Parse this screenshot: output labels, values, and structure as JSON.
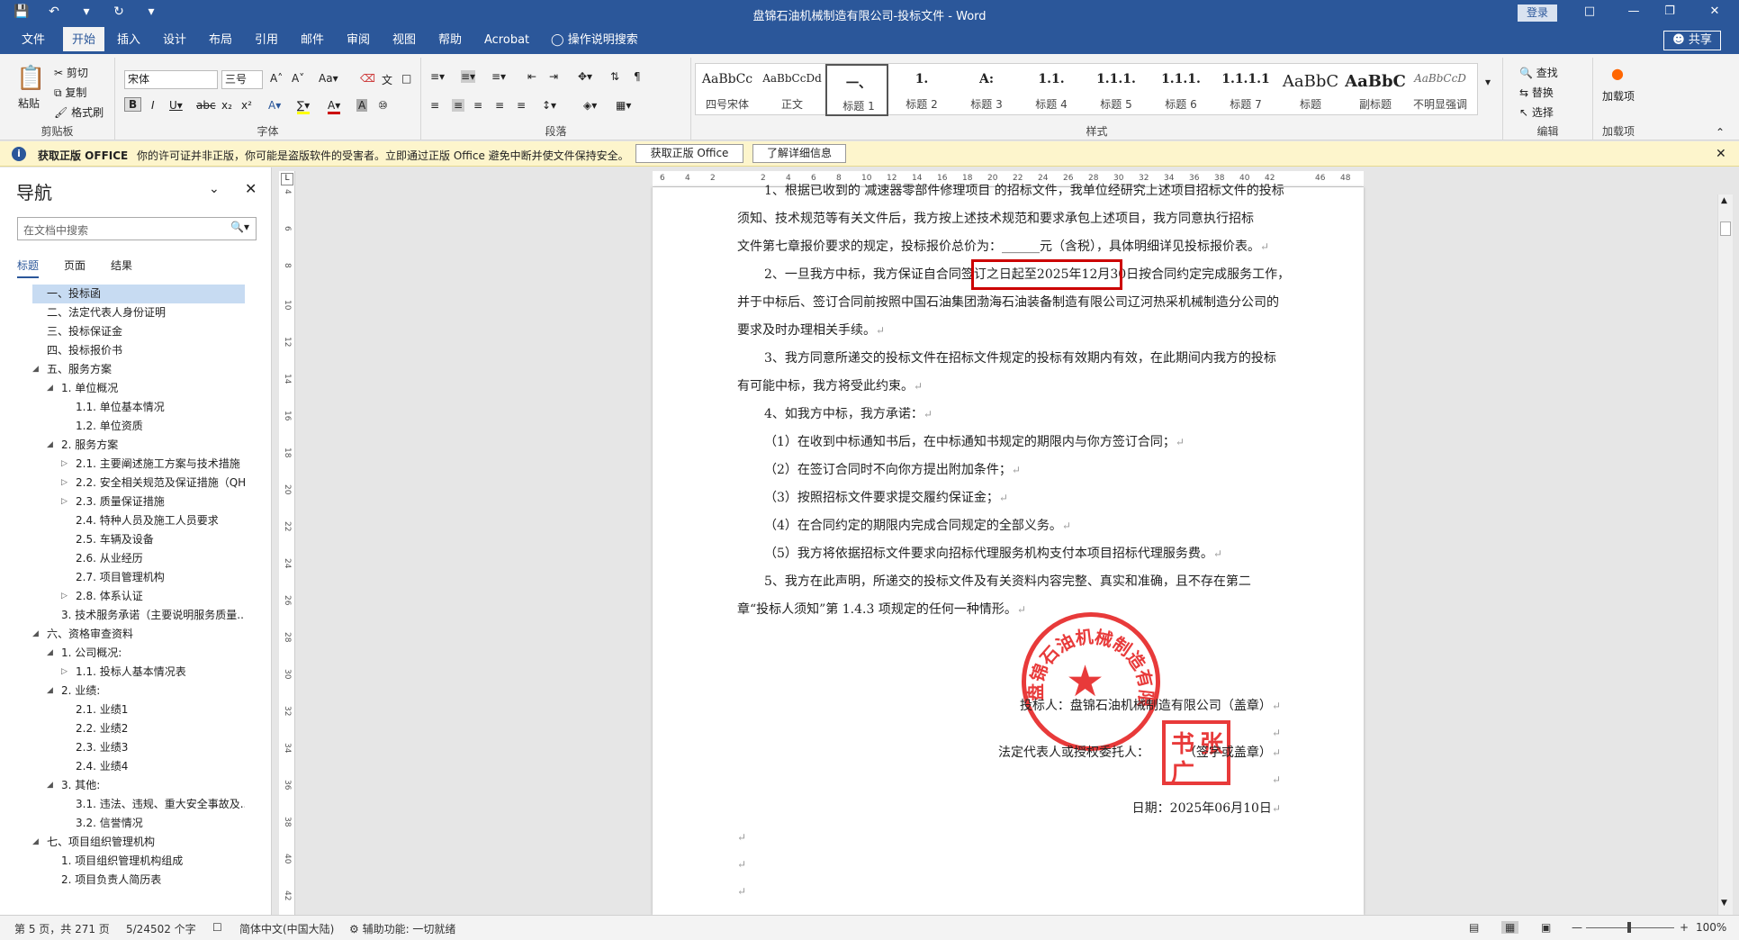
{
  "titlebar": {
    "title": "盘锦石油机械制造有限公司-投标文件  -  Word",
    "login": "登录"
  },
  "tabs": [
    "文件",
    "开始",
    "插入",
    "设计",
    "布局",
    "引用",
    "邮件",
    "审阅",
    "视图",
    "帮助",
    "Acrobat",
    "操作说明搜索"
  ],
  "share_label": "共享",
  "ribbon": {
    "clipboard": {
      "paste": "粘贴",
      "cut": "剪切",
      "copy": "复制",
      "format_painter": "格式刷",
      "label": "剪贴板"
    },
    "font": {
      "name": "宋体",
      "size": "三号",
      "label": "字体"
    },
    "paragraph": {
      "label": "段落"
    },
    "styles": {
      "label": "样式",
      "items": [
        {
          "preview": "AaBbCc",
          "name": "四号宋体"
        },
        {
          "preview": "AaBbCcDd",
          "name": "正文"
        },
        {
          "preview": "一、",
          "name": "标题 1"
        },
        {
          "preview": "1.",
          "name": "标题 2"
        },
        {
          "preview": "A:",
          "name": "标题 3"
        },
        {
          "preview": "1.1.",
          "name": "标题 4"
        },
        {
          "preview": "1.1.1.",
          "name": "标题 5"
        },
        {
          "preview": "1.1.1.",
          "name": "标题 6"
        },
        {
          "preview": "1.1.1.1",
          "name": "标题 7"
        },
        {
          "preview": "AaBbC",
          "name": "标题"
        },
        {
          "preview": "AaBbC",
          "name": "副标题"
        },
        {
          "preview": "AaBbCcD",
          "name": "不明显强调"
        }
      ]
    },
    "editing": {
      "find": "查找",
      "replace": "替换",
      "select": "选择",
      "label": "编辑"
    },
    "addins": {
      "button": "加载项",
      "label": "加载项"
    }
  },
  "message_bar": {
    "bold": "获取正版 OFFICE",
    "text": "你的许可证并非正版，你可能是盗版软件的受害者。立即通过正版 Office 避免中断并使文件保持安全。",
    "btn1": "获取正版 Office",
    "btn2": "了解详细信息"
  },
  "nav": {
    "heading": "导航",
    "search_placeholder": "在文档中搜索",
    "tabs": [
      "标题",
      "页面",
      "结果"
    ],
    "items": [
      {
        "text": "一、投标函",
        "indent": 0,
        "selected": true,
        "expand": ""
      },
      {
        "text": "二、法定代表人身份证明",
        "indent": 0,
        "expand": ""
      },
      {
        "text": "三、投标保证金",
        "indent": 0,
        "expand": ""
      },
      {
        "text": "四、投标报价书",
        "indent": 0,
        "expand": ""
      },
      {
        "text": "五、服务方案",
        "indent": 0,
        "expand": "open"
      },
      {
        "text": "1. 单位概况",
        "indent": 1,
        "expand": "open"
      },
      {
        "text": "1.1. 单位基本情况",
        "indent": 2,
        "expand": ""
      },
      {
        "text": "1.2. 单位资质",
        "indent": 2,
        "expand": ""
      },
      {
        "text": "2. 服务方案",
        "indent": 1,
        "expand": "open"
      },
      {
        "text": "2.1. 主要阐述施工方案与技术措施",
        "indent": 2,
        "expand": "closed"
      },
      {
        "text": "2.2. 安全相关规范及保证措施（QH...",
        "indent": 2,
        "expand": "closed"
      },
      {
        "text": "2.3. 质量保证措施",
        "indent": 2,
        "expand": "closed"
      },
      {
        "text": "2.4. 特种人员及施工人员要求",
        "indent": 2,
        "expand": ""
      },
      {
        "text": "2.5. 车辆及设备",
        "indent": 2,
        "expand": ""
      },
      {
        "text": "2.6. 从业经历",
        "indent": 2,
        "expand": ""
      },
      {
        "text": "2.7. 项目管理机构",
        "indent": 2,
        "expand": ""
      },
      {
        "text": "2.8. 体系认证",
        "indent": 2,
        "expand": "closed"
      },
      {
        "text": "3. 技术服务承诺（主要说明服务质量...",
        "indent": 1,
        "expand": ""
      },
      {
        "text": "六、资格审查资料",
        "indent": 0,
        "expand": "open"
      },
      {
        "text": "1. 公司概况:",
        "indent": 1,
        "expand": "open"
      },
      {
        "text": "1.1. 投标人基本情况表",
        "indent": 2,
        "expand": "closed"
      },
      {
        "text": "2. 业绩:",
        "indent": 1,
        "expand": "open"
      },
      {
        "text": "2.1. 业绩1",
        "indent": 2,
        "expand": ""
      },
      {
        "text": "2.2. 业绩2",
        "indent": 2,
        "expand": ""
      },
      {
        "text": "2.3. 业绩3",
        "indent": 2,
        "expand": ""
      },
      {
        "text": "2.4. 业绩4",
        "indent": 2,
        "expand": ""
      },
      {
        "text": "3. 其他:",
        "indent": 1,
        "expand": "open"
      },
      {
        "text": "3.1. 违法、违规、重大安全事故及...",
        "indent": 2,
        "expand": ""
      },
      {
        "text": "3.2. 信誉情况",
        "indent": 2,
        "expand": ""
      },
      {
        "text": "七、项目组织管理机构",
        "indent": 0,
        "expand": "open"
      },
      {
        "text": "1. 项目组织管理机构组成",
        "indent": 1,
        "expand": ""
      },
      {
        "text": "2. 项目负责人简历表",
        "indent": 1,
        "expand": ""
      }
    ]
  },
  "hruler_ticks": [
    "6",
    "4",
    "2",
    "",
    "2",
    "4",
    "6",
    "8",
    "10",
    "12",
    "14",
    "16",
    "18",
    "20",
    "22",
    "24",
    "26",
    "28",
    "30",
    "32",
    "34",
    "36",
    "38",
    "40",
    "42",
    "",
    "46",
    "48"
  ],
  "vruler_ticks": [
    "4",
    "6",
    "8",
    "10",
    "12",
    "14",
    "16",
    "18",
    "20",
    "22",
    "24",
    "26",
    "28",
    "30",
    "32",
    "34",
    "36",
    "38",
    "40",
    "42"
  ],
  "doc": {
    "lines": [
      {
        "text": "1、根据已收到的 减速器零部件修理项目 的招标文件，我单位经研究上述项目招标文件的投标",
        "indent": 30
      },
      {
        "text": "须知、技术规范等有关文件后，我方按上述技术规范和要求承包上述项目，我方同意执行招标",
        "indent": 0
      },
      {
        "text": "文件第七章报价要求的规定，投标报价总价为：______元（含税），具体明细详见投标报价表。",
        "indent": 0,
        "mark": "↵"
      },
      {
        "text": "2、一旦我方中标，我方保证自合同签订之日起至2025年12月30日按合同约定完成服务工作，",
        "indent": 30
      },
      {
        "text": "并于中标后、签订合同前按照中国石油集团渤海石油装备制造有限公司辽河热采机械制造分公司的",
        "indent": 0
      },
      {
        "text": "要求及时办理相关手续。",
        "indent": 0,
        "mark": "↵"
      },
      {
        "text": "3、我方同意所递交的投标文件在招标文件规定的投标有效期内有效，在此期间内我方的投标",
        "indent": 30
      },
      {
        "text": "有可能中标，我方将受此约束。",
        "indent": 0,
        "mark": "↵"
      },
      {
        "text": "4、如我方中标，我方承诺：",
        "indent": 30,
        "mark": "↵"
      },
      {
        "text": "（1）在收到中标通知书后，在中标通知书规定的期限内与你方签订合同；",
        "indent": 30,
        "mark": "↵"
      },
      {
        "text": "（2）在签订合同时不向你方提出附加条件；",
        "indent": 30,
        "mark": "↵"
      },
      {
        "text": "（3）按照招标文件要求提交履约保证金；",
        "indent": 30,
        "mark": "↵"
      },
      {
        "text": "（4）在合同约定的期限内完成合同规定的全部义务。",
        "indent": 30,
        "mark": "↵"
      },
      {
        "text": "（5）我方将依据招标文件要求向招标代理服务机构支付本项目招标代理服务费。",
        "indent": 30,
        "mark": "↵"
      },
      {
        "text": "5、我方在此声明，所递交的投标文件及有关资料内容完整、真实和准确，且不存在第二",
        "indent": 30
      },
      {
        "text": "章“投标人须知”第 1.4.3 项规定的任何一种情形。",
        "indent": 0,
        "mark": "↵"
      }
    ],
    "bidder": "投标人：盘锦石油机械制造有限公司（盖章）",
    "legal_rep": "法定代表人或授权委托人：",
    "sign_note": "（签字或盖章）",
    "date": "日期：2025年06月10日",
    "para_mark": "↵",
    "seal_text": "盘锦石油机械制造有限公司",
    "stamp_chars": [
      "张",
      "书",
      "广"
    ]
  },
  "status": {
    "page": "第 5 页，共 271 页",
    "words": "5/24502 个字",
    "lang": "简体中文(中国大陆)",
    "access": "辅助功能: 一切就绪",
    "zoom": "100%"
  },
  "colors": {
    "accent": "#2b579a",
    "seal_red": "#e83a3a",
    "box_red": "#cc0000"
  }
}
